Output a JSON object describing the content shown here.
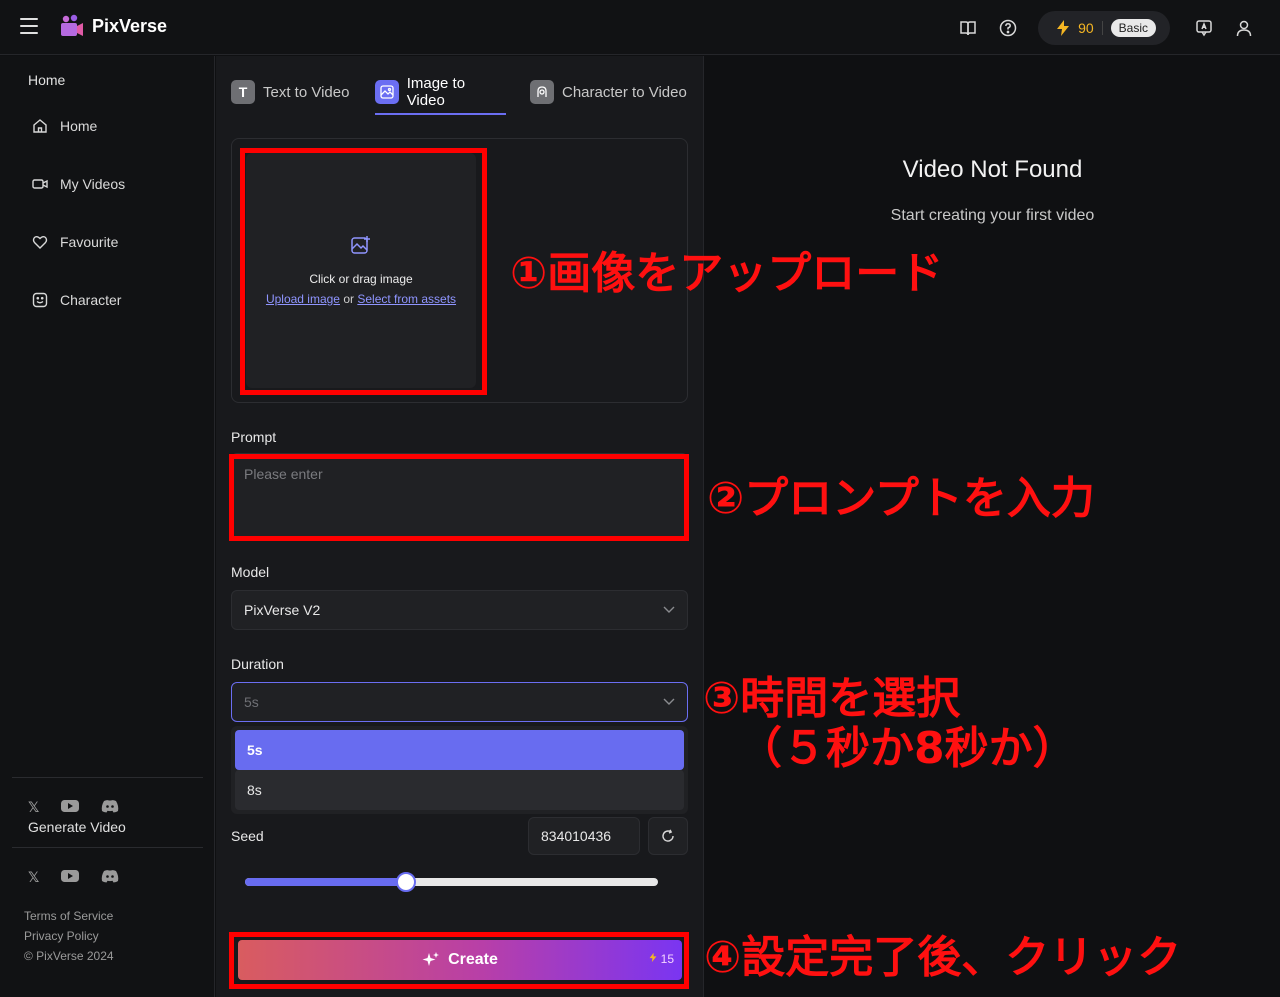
{
  "app": {
    "logo_text": "PixVerse"
  },
  "topbar": {
    "credits": "90",
    "plan_badge": "Basic"
  },
  "sidebar": {
    "heading": "Home",
    "items": [
      {
        "label": "Home",
        "icon": "home-icon"
      },
      {
        "label": "My Videos",
        "icon": "video-icon"
      },
      {
        "label": "Favourite",
        "icon": "heart-icon"
      },
      {
        "label": "Character",
        "icon": "smile-icon"
      }
    ],
    "generate_label": "Generate Video",
    "links": [
      "Terms of Service",
      "Privacy Policy",
      "© PixVerse 2024"
    ]
  },
  "tabs": [
    {
      "label": "Text to Video",
      "active": false
    },
    {
      "label": "Image to Video",
      "active": true
    },
    {
      "label": "Character to Video",
      "active": false
    }
  ],
  "upload": {
    "title": "Click or drag image",
    "upload_link": "Upload image",
    "or": "or",
    "assets_link": "Select from assets"
  },
  "prompt": {
    "label": "Prompt",
    "placeholder": "Please enter"
  },
  "model": {
    "label": "Model",
    "value": "PixVerse V2"
  },
  "duration": {
    "label": "Duration",
    "value": "5s",
    "options": [
      "5s",
      "8s"
    ],
    "selected": "5s"
  },
  "seed": {
    "label": "Seed",
    "value": "834010436",
    "slider_fraction": 0.39
  },
  "create": {
    "label": "Create",
    "cost": "15"
  },
  "preview": {
    "title": "Video Not Found",
    "subtitle": "Start creating your first video"
  },
  "annotations": {
    "step1": "①画像をアップロード",
    "step2": "②プロンプトを入力",
    "step3_line1": "③時間を選択",
    "step3_line2": "（５秒か8秒か）",
    "step4": "④設定完了後、クリック"
  },
  "colors": {
    "accent": "#686cf0",
    "annotation": "#ff0000",
    "credit": "#f5b623"
  }
}
